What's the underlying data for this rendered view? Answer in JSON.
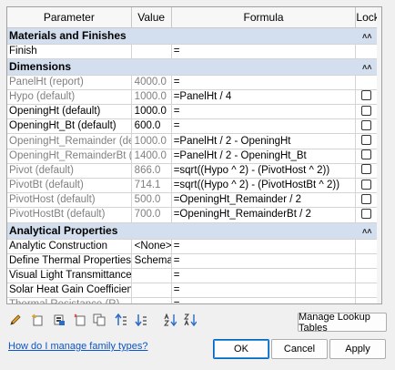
{
  "columns": {
    "parameter": "Parameter",
    "value": "Value",
    "formula": "Formula",
    "lock": "Lock"
  },
  "groups": [
    {
      "title": "Materials and Finishes",
      "rows": [
        {
          "param": "Finish",
          "value": "",
          "formula": "=",
          "gray": false,
          "lock": false
        }
      ]
    },
    {
      "title": "Dimensions",
      "rows": [
        {
          "param": "PanelHt (report)",
          "value": "4000.0",
          "formula": "=",
          "gray": true,
          "lock": false
        },
        {
          "param": "Hypo (default)",
          "value": "1000.0",
          "formula": "=PanelHt / 4",
          "gray": true,
          "lock": true
        },
        {
          "param": "OpeningHt (default)",
          "value": "1000.0",
          "formula": "=",
          "gray": false,
          "lock": true
        },
        {
          "param": "OpeningHt_Bt (default)",
          "value": "600.0",
          "formula": "=",
          "gray": false,
          "lock": true
        },
        {
          "param": "OpeningHt_Remainder (defa",
          "value": "1000.0",
          "formula": "=PanelHt / 2 - OpeningHt",
          "gray": true,
          "lock": true
        },
        {
          "param": "OpeningHt_RemainderBt (de",
          "value": "1400.0",
          "formula": "=PanelHt / 2 - OpeningHt_Bt",
          "gray": true,
          "lock": true
        },
        {
          "param": "Pivot (default)",
          "value": "866.0",
          "formula": "=sqrt((Hypo ^ 2) - (PivotHost ^ 2))",
          "gray": true,
          "lock": true
        },
        {
          "param": "PivotBt (default)",
          "value": "714.1",
          "formula": "=sqrt((Hypo ^ 2) - (PivotHostBt ^ 2))",
          "gray": true,
          "lock": true
        },
        {
          "param": "PivotHost (default)",
          "value": "500.0",
          "formula": "=OpeningHt_Remainder / 2",
          "gray": true,
          "lock": true
        },
        {
          "param": "PivotHostBt (default)",
          "value": "700.0",
          "formula": "=OpeningHt_RemainderBt / 2",
          "gray": true,
          "lock": true
        }
      ]
    },
    {
      "title": "Analytical Properties",
      "rows": [
        {
          "param": "Analytic Construction",
          "value": "<None>",
          "formula": "=",
          "gray": false,
          "lock": false
        },
        {
          "param": "Define Thermal Properties by",
          "value": "Schemati",
          "formula": "=",
          "gray": false,
          "lock": false
        },
        {
          "param": "Visual Light Transmittance",
          "value": "",
          "formula": "=",
          "gray": false,
          "lock": false
        },
        {
          "param": "Solar Heat Gain Coefficient",
          "value": "",
          "formula": "=",
          "gray": false,
          "lock": false
        },
        {
          "param": "Thermal Resistance (R)",
          "value": "",
          "formula": "=",
          "gray": true,
          "lock": false
        }
      ]
    }
  ],
  "toolbar": {
    "icons": [
      "edit-parameter-icon",
      "new-parameter-icon",
      "delete-parameter-icon",
      "move-up-icon",
      "move-down-icon",
      "sort-up-icon",
      "sort-down-icon",
      "sort-ascending-icon",
      "sort-descending-icon"
    ],
    "lookup_label": "Manage Lookup Tables"
  },
  "help_link": "How do I manage family types?",
  "buttons": {
    "ok": "OK",
    "cancel": "Cancel",
    "apply": "Apply"
  },
  "colors": {
    "group_header": "#d3dfee",
    "link": "#0b55c8",
    "gray_text": "#808080"
  }
}
